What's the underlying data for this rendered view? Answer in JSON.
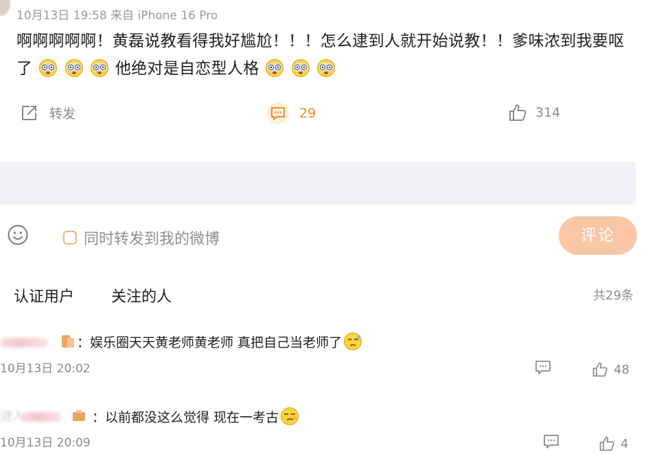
{
  "post": {
    "meta": "10月13日 19:58  来自 iPhone 16 Pro",
    "text_line1": "啊啊啊啊啊！黄磊说教看得我好尴尬！！！怎么逮到人就开始说教！！爹味浓到我要呕",
    "text_line2_a": "了",
    "text_line2_b": " 他绝对是自恋型人格",
    "emoji": "dizzy-face-emoji"
  },
  "actions": {
    "repost_label": "转发",
    "comment_count": "29",
    "like_count": "314"
  },
  "composer": {
    "also_repost_label": "同时转发到我的微博",
    "submit_label": "评论"
  },
  "filter_tabs": {
    "tab1": "认证用户",
    "tab2": "关注的人",
    "total": "共29条"
  },
  "comments": [
    {
      "text": "：娱乐圈天天黄老师黄老师 真把自己当老师了",
      "time": "10月13日 20:02",
      "likes": "48",
      "emoji": "sweat-face-emoji"
    },
    {
      "name_fragment": "进入",
      "text": "：以前都没这么觉得 现在一考古",
      "time": "10月13日 20:09",
      "likes": "4",
      "emoji": "smirk-face-emoji"
    }
  ],
  "colors": {
    "accent_orange": "#ef8b1f",
    "submit_bg": "#f9c7a6",
    "gray_input": "#f1f2f5"
  }
}
